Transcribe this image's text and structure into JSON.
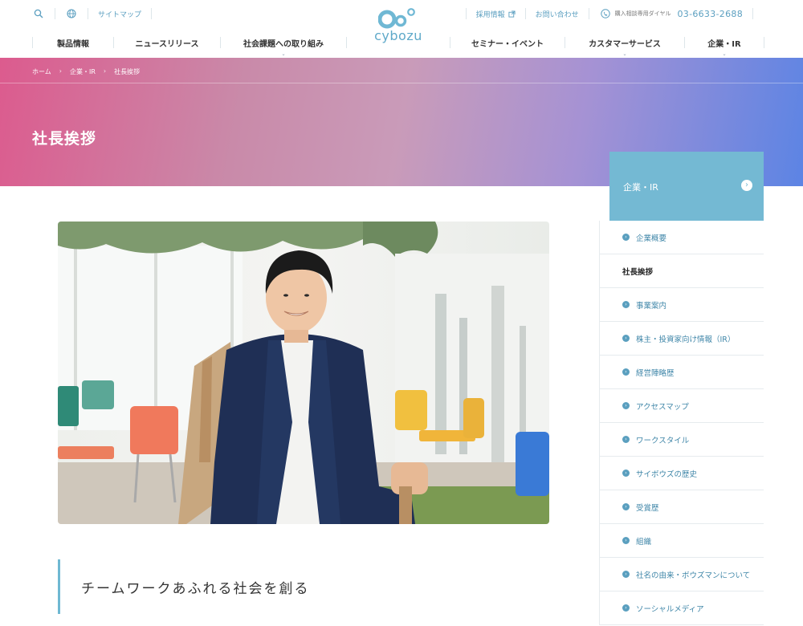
{
  "header": {
    "utility_left": {
      "sitemap": "サイトマップ"
    },
    "utility_right": {
      "recruit": "採用情報",
      "contact": "お問い合わせ",
      "phone_label": "購入相談専用ダイヤル",
      "phone_number": "03-6633-2688"
    },
    "logo_text": "cybozu",
    "nav_left": [
      "製品情報",
      "ニュースリリース",
      "社会課題への取り組み"
    ],
    "nav_right": [
      "セミナー・イベント",
      "カスタマーサービス",
      "企業・IR"
    ]
  },
  "breadcrumb": [
    "ホーム",
    "企業・IR",
    "社長挨拶"
  ],
  "hero": {
    "title": "社長挨拶"
  },
  "content": {
    "heading": "チームワークあふれる社会を創る"
  },
  "sidebar": {
    "head": "企業・IR",
    "items": [
      {
        "label": "企業概要",
        "active": false
      },
      {
        "label": "社長挨拶",
        "active": true
      },
      {
        "label": "事業案内",
        "active": false
      },
      {
        "label": "株主・投資家向け情報（IR）",
        "active": false
      },
      {
        "label": "経営陣略歴",
        "active": false
      },
      {
        "label": "アクセスマップ",
        "active": false
      },
      {
        "label": "ワークスタイル",
        "active": false
      },
      {
        "label": "サイボウズの歴史",
        "active": false
      },
      {
        "label": "受賞歴",
        "active": false
      },
      {
        "label": "組織",
        "active": false
      },
      {
        "label": "社名の由来・ボウズマンについて",
        "active": false
      },
      {
        "label": "ソーシャルメディア",
        "active": false
      }
    ]
  },
  "colors": {
    "accent": "#74b9d3",
    "link": "#3f86a8",
    "hero_start": "#dc5b8e",
    "hero_end": "#5c84e4"
  }
}
